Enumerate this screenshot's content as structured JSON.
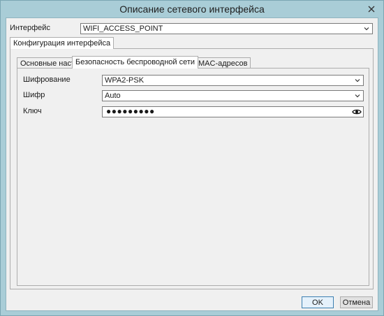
{
  "window": {
    "title": "Описание сетевого интерфейса",
    "close_icon": "close-icon"
  },
  "interface": {
    "label": "Интерфейс",
    "value": "WIFI_ACCESS_POINT"
  },
  "outer_tab": {
    "label": "Конфигурация интерфейса"
  },
  "inner_tabs": [
    {
      "label": "Основные настройки",
      "active": false
    },
    {
      "label": "Безопасность беспроводной сети",
      "active": true
    },
    {
      "label": "Фильтр MAC-адресов",
      "active": false
    }
  ],
  "encryption": {
    "label": "Шифрование",
    "value": "WPA2-PSK"
  },
  "cipher": {
    "label": "Шифр",
    "value": "Auto"
  },
  "key": {
    "label": "Ключ",
    "value": "●●●●●●●●●",
    "toggle_icon": "eye-icon"
  },
  "buttons": {
    "ok": "OK",
    "cancel": "Отмена"
  },
  "colors": {
    "titlebar": "#a9cdd7",
    "client_bg": "#f0f0f0",
    "default_button_border": "#3c7fb1"
  }
}
